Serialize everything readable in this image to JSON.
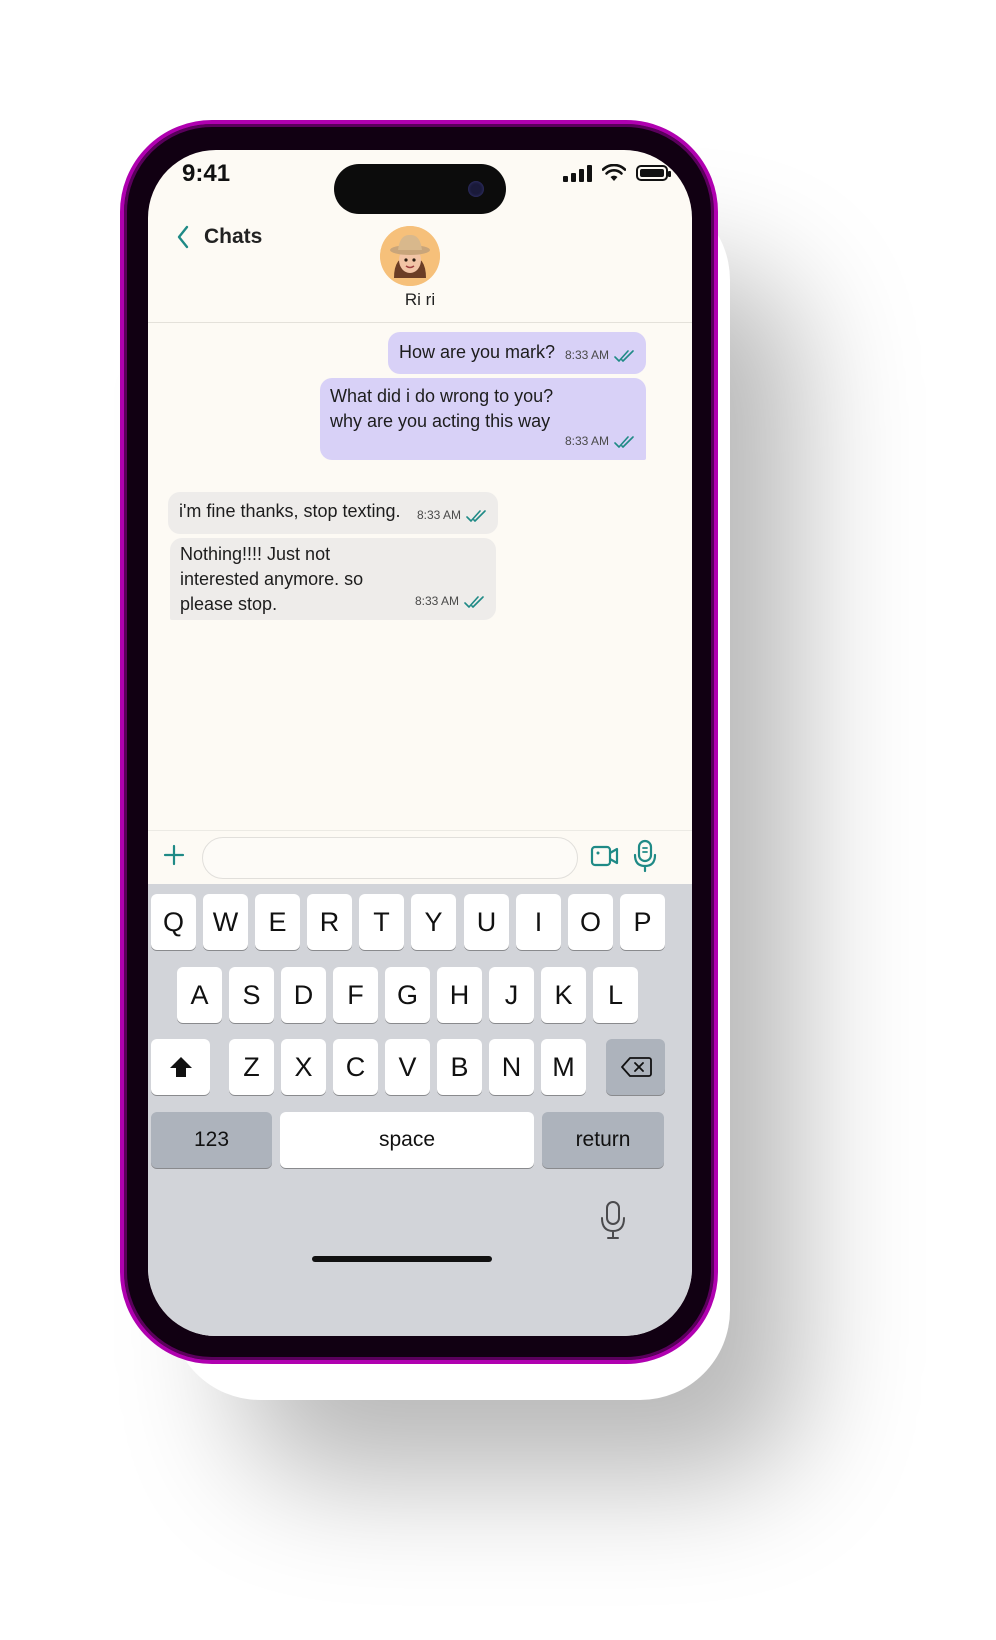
{
  "status_bar": {
    "time": "9:41",
    "icons": [
      "signal-icon",
      "wifi-icon",
      "battery-icon"
    ]
  },
  "header": {
    "back_label": "Chats",
    "contact_name": "Ri ri",
    "back_icon": "chevron-left-icon"
  },
  "messages": [
    {
      "direction": "outgoing",
      "text": "How are you mark?",
      "time": "8:33 AM",
      "status": "read"
    },
    {
      "direction": "outgoing",
      "text": "What did i do wrong to you?\nwhy are you acting this way",
      "time": "8:33 AM",
      "status": "read"
    },
    {
      "direction": "incoming",
      "text": "i'm fine thanks, stop texting.",
      "time": "8:33 AM",
      "status": "read"
    },
    {
      "direction": "incoming",
      "text": "Nothing!!!! Just not\ninterested anymore. so\nplease stop.",
      "time": "8:33 AM",
      "status": "read"
    }
  ],
  "composer": {
    "placeholder": "",
    "value": "",
    "icons": [
      "plus-icon",
      "video-camera-icon",
      "microphone-icon"
    ]
  },
  "keyboard": {
    "row1": [
      "Q",
      "W",
      "E",
      "R",
      "T",
      "Y",
      "U",
      "I",
      "O",
      "P"
    ],
    "row2": [
      "A",
      "S",
      "D",
      "F",
      "G",
      "H",
      "J",
      "K",
      "L"
    ],
    "row3": [
      "Z",
      "X",
      "C",
      "V",
      "B",
      "N",
      "M"
    ],
    "numbers_label": "123",
    "space_label": "space",
    "return_label": "return"
  },
  "colors": {
    "accent": "#1f8a86",
    "outgoing_bubble": "#d8d1f7",
    "incoming_bubble": "#eeecea",
    "frame": "#b000b0"
  }
}
